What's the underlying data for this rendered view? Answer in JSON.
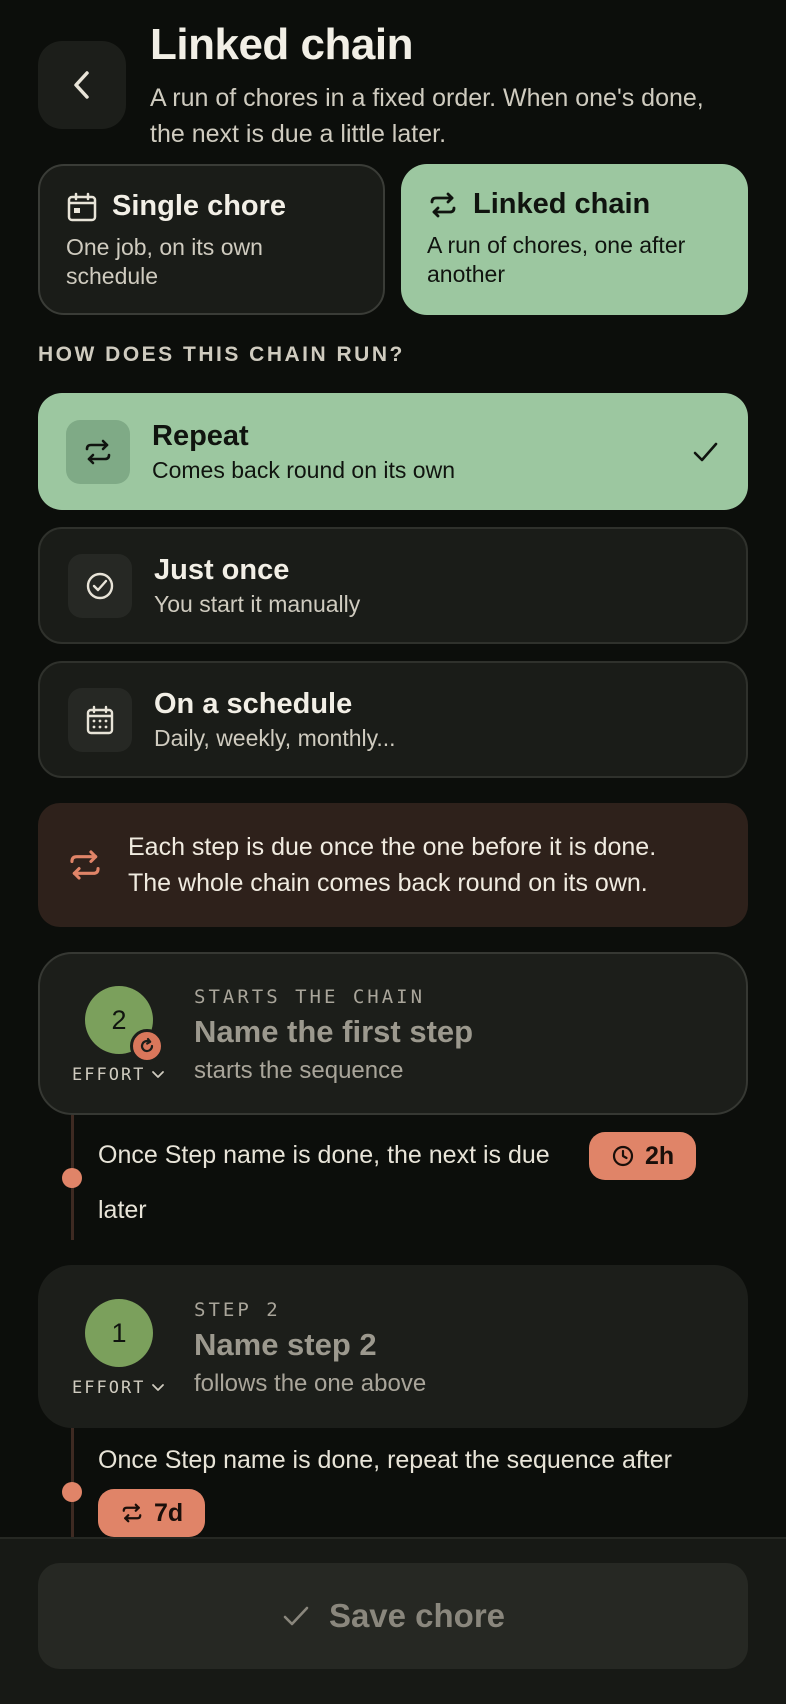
{
  "header": {
    "title": "Linked chain",
    "subtitle": "A run of chores in a fixed order. When one's done, the next is due a little later."
  },
  "type_toggle": [
    {
      "label": "Single chore",
      "description": "One job, on its own schedule",
      "selected": false
    },
    {
      "label": "Linked chain",
      "description": "A run of chores, one after another",
      "selected": true
    }
  ],
  "section_label": "HOW DOES THIS CHAIN RUN?",
  "run_options": [
    {
      "title": "Repeat",
      "subtitle": "Comes back round on its own",
      "selected": true
    },
    {
      "title": "Just once",
      "subtitle": "You start it manually",
      "selected": false
    },
    {
      "title": "On a schedule",
      "subtitle": "Daily, weekly, monthly...",
      "selected": false
    }
  ],
  "info": {
    "line1": "Each step is due once the one before it is done.",
    "line2": "The whole chain comes back round on its own."
  },
  "steps": [
    {
      "effort": "2",
      "effort_label": "EFFORT",
      "kicker": "STARTS THE CHAIN",
      "name": "Name the first step",
      "sub": "starts the sequence"
    },
    {
      "effort": "1",
      "effort_label": "EFFORT",
      "kicker": "STEP 2",
      "name": "Name step 2",
      "sub": "follows the one above"
    }
  ],
  "connectors": [
    {
      "text": "Once Step name is done, the next is due",
      "pill": "2h",
      "after": "later"
    },
    {
      "text": "Once Step name is done, repeat the sequence after",
      "pill": "7d"
    }
  ],
  "save_label": "Save chore",
  "colors": {
    "accent_green": "#9cc7a0",
    "accent_orange": "#e08468",
    "background": "#0c0e0b"
  }
}
